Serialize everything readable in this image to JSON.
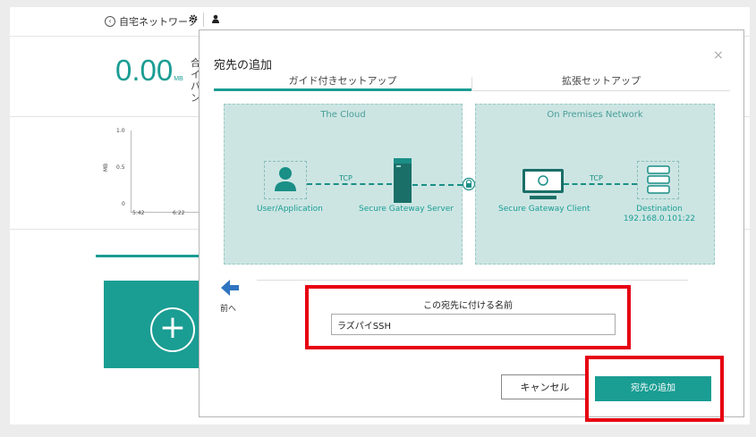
{
  "background": {
    "header_network": "自宅ネットワーク",
    "stat_value": "0.00",
    "stat_unit": "MB",
    "cut_text": "合 イ パ ン",
    "chart_y_label": "MB",
    "chart_ticks_y": [
      "1.0",
      "0.5",
      "0"
    ],
    "chart_ticks_x": [
      "5:42",
      "6:22"
    ]
  },
  "dialog": {
    "title": "宛先の追加",
    "close": "×",
    "tabs": [
      {
        "label": "ガイド付きセットアップ",
        "active": true
      },
      {
        "label": "拡張セットアップ",
        "active": false
      }
    ],
    "diagram": {
      "cloud_zone": "The Cloud",
      "premises_zone": "On Premises Network",
      "user_app": "User/Application",
      "gateway_server": "Secure Gateway Server",
      "gateway_client": "Secure Gateway Client",
      "destination": "Destination",
      "destination_addr": "192.168.0.101:22",
      "protocol_left": "TCP",
      "protocol_right": "TCP"
    },
    "prev_label": "前へ",
    "name_label": "この宛先に付ける名前",
    "name_value": "ラズパイSSH",
    "cancel_label": "キャンセル",
    "add_label": "宛先の追加"
  },
  "colors": {
    "accent": "#1a9d93",
    "highlight": "#e60012",
    "zone": "#cce5e3"
  }
}
